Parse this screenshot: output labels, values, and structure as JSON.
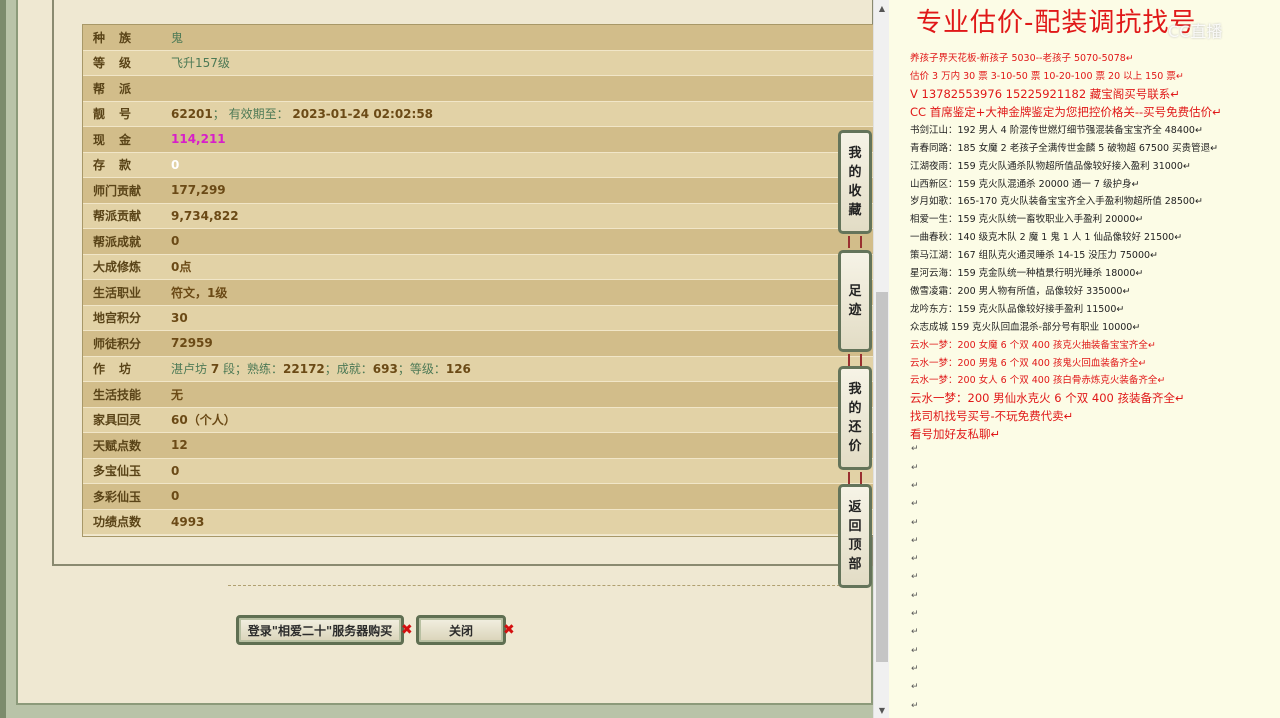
{
  "character": {
    "rows": [
      {
        "label": "种族",
        "value": "鬼",
        "style": "green",
        "spaced": true
      },
      {
        "label": "等级",
        "value": "飞升157级",
        "style": "green",
        "spaced": true
      },
      {
        "label": "帮派",
        "value": "",
        "style": "",
        "spaced": true
      },
      {
        "label": "靓号",
        "value": "62201",
        "extra_label": "有效期至：",
        "extra_value": "2023-01-24 02:02:58",
        "style": "",
        "spaced": true
      },
      {
        "label": "现金",
        "value": "114,211",
        "style": "magenta",
        "spaced": true
      },
      {
        "label": "存款",
        "value": "0",
        "style": "white",
        "spaced": true
      },
      {
        "label": "师门贡献",
        "value": "177,299",
        "style": ""
      },
      {
        "label": "帮派贡献",
        "value": "9,734,822",
        "style": ""
      },
      {
        "label": "帮派成就",
        "value": "0",
        "style": ""
      },
      {
        "label": "大成修炼",
        "value": "0点",
        "style": ""
      },
      {
        "label": "生活职业",
        "value": "符文，1级",
        "style": ""
      },
      {
        "label": "地宫积分",
        "value": "30",
        "style": ""
      },
      {
        "label": "师徒积分",
        "value": "72959",
        "style": ""
      },
      {
        "label": "作坊",
        "value": "",
        "workshop": {
          "name": "湛卢坊",
          "rank": "7",
          "rank_unit": "段；熟练：",
          "skill": "22172",
          "sep1": "；成就：",
          "achieve": "693",
          "sep2": "；等级：",
          "level": "126"
        },
        "spaced": true
      },
      {
        "label": "生活技能",
        "value": "无",
        "style": ""
      },
      {
        "label": "家具回灵",
        "value": "60（个人）",
        "style": ""
      },
      {
        "label": "天赋点数",
        "value": "12",
        "style": ""
      },
      {
        "label": "多宝仙玉",
        "value": "0",
        "style": ""
      },
      {
        "label": "多彩仙玉",
        "value": "0",
        "style": ""
      },
      {
        "label": "功绩点数",
        "value": "4993",
        "style": ""
      }
    ]
  },
  "buttons": {
    "login_buy": "登录\"相爱二十\"服务器购买",
    "close": "关闭",
    "x_mark": "✖"
  },
  "side_tabs": {
    "favorites": [
      "我",
      "的",
      "收",
      "藏"
    ],
    "footprints": [
      "足",
      "迹"
    ],
    "my_offers": [
      "我",
      "的",
      "还",
      "价"
    ],
    "back_top": [
      "返",
      "回",
      "顶",
      "部"
    ]
  },
  "text_panel": {
    "title": "专业估价-配装调抗找号",
    "watermark": "CC直播",
    "lines": [
      {
        "text": "养孩子界天花板-新孩子 5030--老孩子 5070-5078",
        "color": "red",
        "size": "small"
      },
      {
        "text": "估价 3 万内 30 票    3-10-50 票    10-20-100 票    20 以上 150 票",
        "color": "red",
        "size": "small"
      },
      {
        "text": "V 13782553976     15225921182   藏宝阁买号联系",
        "color": "red",
        "size": "big"
      },
      {
        "text": "CC 首席鉴定+大神金牌鉴定为您把控价格关--买号免费估价",
        "color": "red",
        "size": "big"
      },
      {
        "text": "书剑江山：192 男人 4 阶混传世燃灯细节强混装备宝宝齐全 48400",
        "color": "black",
        "size": "small"
      },
      {
        "text": "青春同路：185 女魔 2 老孩子全满传世金麟 5 破物超 67500 买贵管退",
        "color": "black",
        "size": "small"
      },
      {
        "text": "江湖夜雨：159 克火队通杀队物超所值品像较好接入盈利 31000",
        "color": "black",
        "size": "small"
      },
      {
        "text": "山西新区：159 克火队混通杀 20000 通一 7 级护身",
        "color": "black",
        "size": "small"
      },
      {
        "text": "岁月如歌：165-170 克火队装备宝宝齐全入手盈利物超所值 28500",
        "color": "black",
        "size": "small"
      },
      {
        "text": "相爱一生：159 克火队统一畜牧职业入手盈利 20000",
        "color": "black",
        "size": "small"
      },
      {
        "text": "一曲春秋：140 级克木队 2 魔 1 鬼 1 人 1 仙品像较好 21500",
        "color": "black",
        "size": "small"
      },
      {
        "text": "策马江湖：167 组队克火通灵睡杀 14-15 没压力 75000",
        "color": "black",
        "size": "small"
      },
      {
        "text": "星河云海：159 克金队统一种植景行明光睡杀 18000",
        "color": "black",
        "size": "small"
      },
      {
        "text": "傲雪凌霜：200 男人物有所值，品像较好 335000",
        "color": "black",
        "size": "small"
      },
      {
        "text": "龙吟东方：159 克火队品像较好接手盈利 11500",
        "color": "black",
        "size": "small"
      },
      {
        "text": "众志成城 159 克火队回血混杀-部分号有职业 10000",
        "color": "black",
        "size": "small"
      },
      {
        "text": "云水一梦：200 女魔 6 个双 400 孩克火抽装备宝宝齐全",
        "color": "red",
        "size": "small"
      },
      {
        "text": "云水一梦：200 男鬼 6 个双 400 孩鬼火回血装备齐全",
        "color": "red",
        "size": "small"
      },
      {
        "text": "云水一梦：200 女人 6 个双 400 孩白骨赤炼克火装备齐全",
        "color": "red",
        "size": "small"
      },
      {
        "text": "云水一梦：200 男仙水克火 6 个双 400 孩装备齐全",
        "color": "red",
        "size": "big"
      },
      {
        "text": "找司机找号买号-不玩免费代卖",
        "color": "red",
        "size": "big"
      },
      {
        "text": "看号加好友私聊",
        "color": "red",
        "size": "big"
      }
    ],
    "paragraph_mark": "↵"
  }
}
